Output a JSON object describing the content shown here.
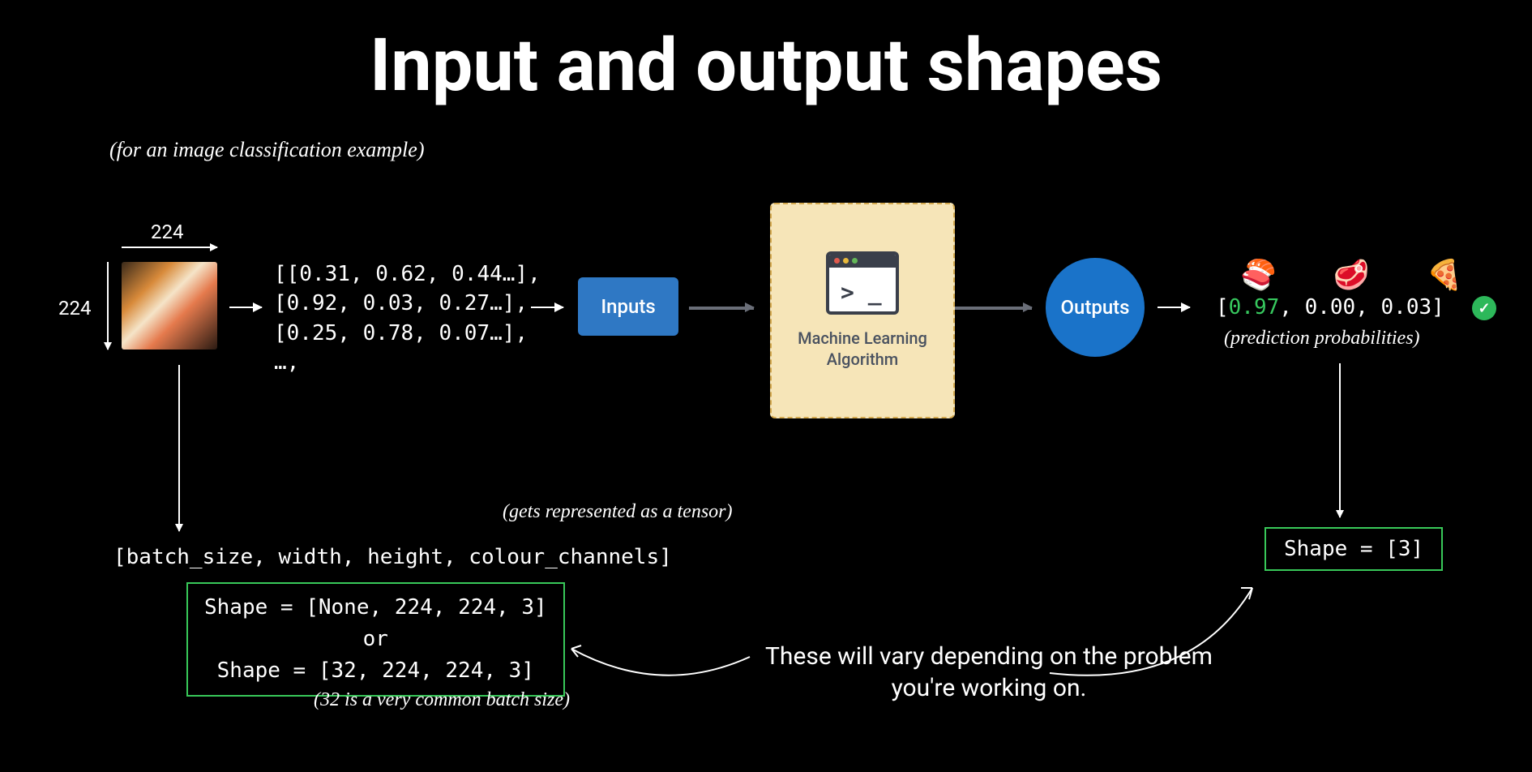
{
  "title": "Input and output shapes",
  "subtitle": "(for an image classification example)",
  "dims": {
    "width": "224",
    "height": "224"
  },
  "matrix": "[[0.31, 0.62, 0.44…],\n[0.92, 0.03, 0.27…],\n[0.25, 0.78, 0.07…],\n…,",
  "inputs_label": "Inputs",
  "ml_label_line1": "Machine Learning",
  "ml_label_line2": "Algorithm",
  "terminal_prompt": "> _",
  "outputs_label": "Outputs",
  "class_icons": {
    "sushi": "🍣",
    "steak": "🥩",
    "pizza": "🍕"
  },
  "output_values": {
    "open": "[",
    "v0": "0.97",
    "sep1": ", ",
    "v1": "0.00",
    "sep2": ", ",
    "v2": "0.03",
    "close": "]"
  },
  "pred_note": "(prediction probabilities)",
  "tensor_note": "(gets represented as a tensor)",
  "shape_desc": "[batch_size, width, height, colour_channels]",
  "shape_box": "Shape = [None, 224, 224, 3]\nor\nShape = [32, 224, 224, 3]",
  "batch_note": "(32 is a very common batch size)",
  "vary_text": "These will vary depending on the problem you're working on.",
  "shape_out": "Shape = [3]"
}
